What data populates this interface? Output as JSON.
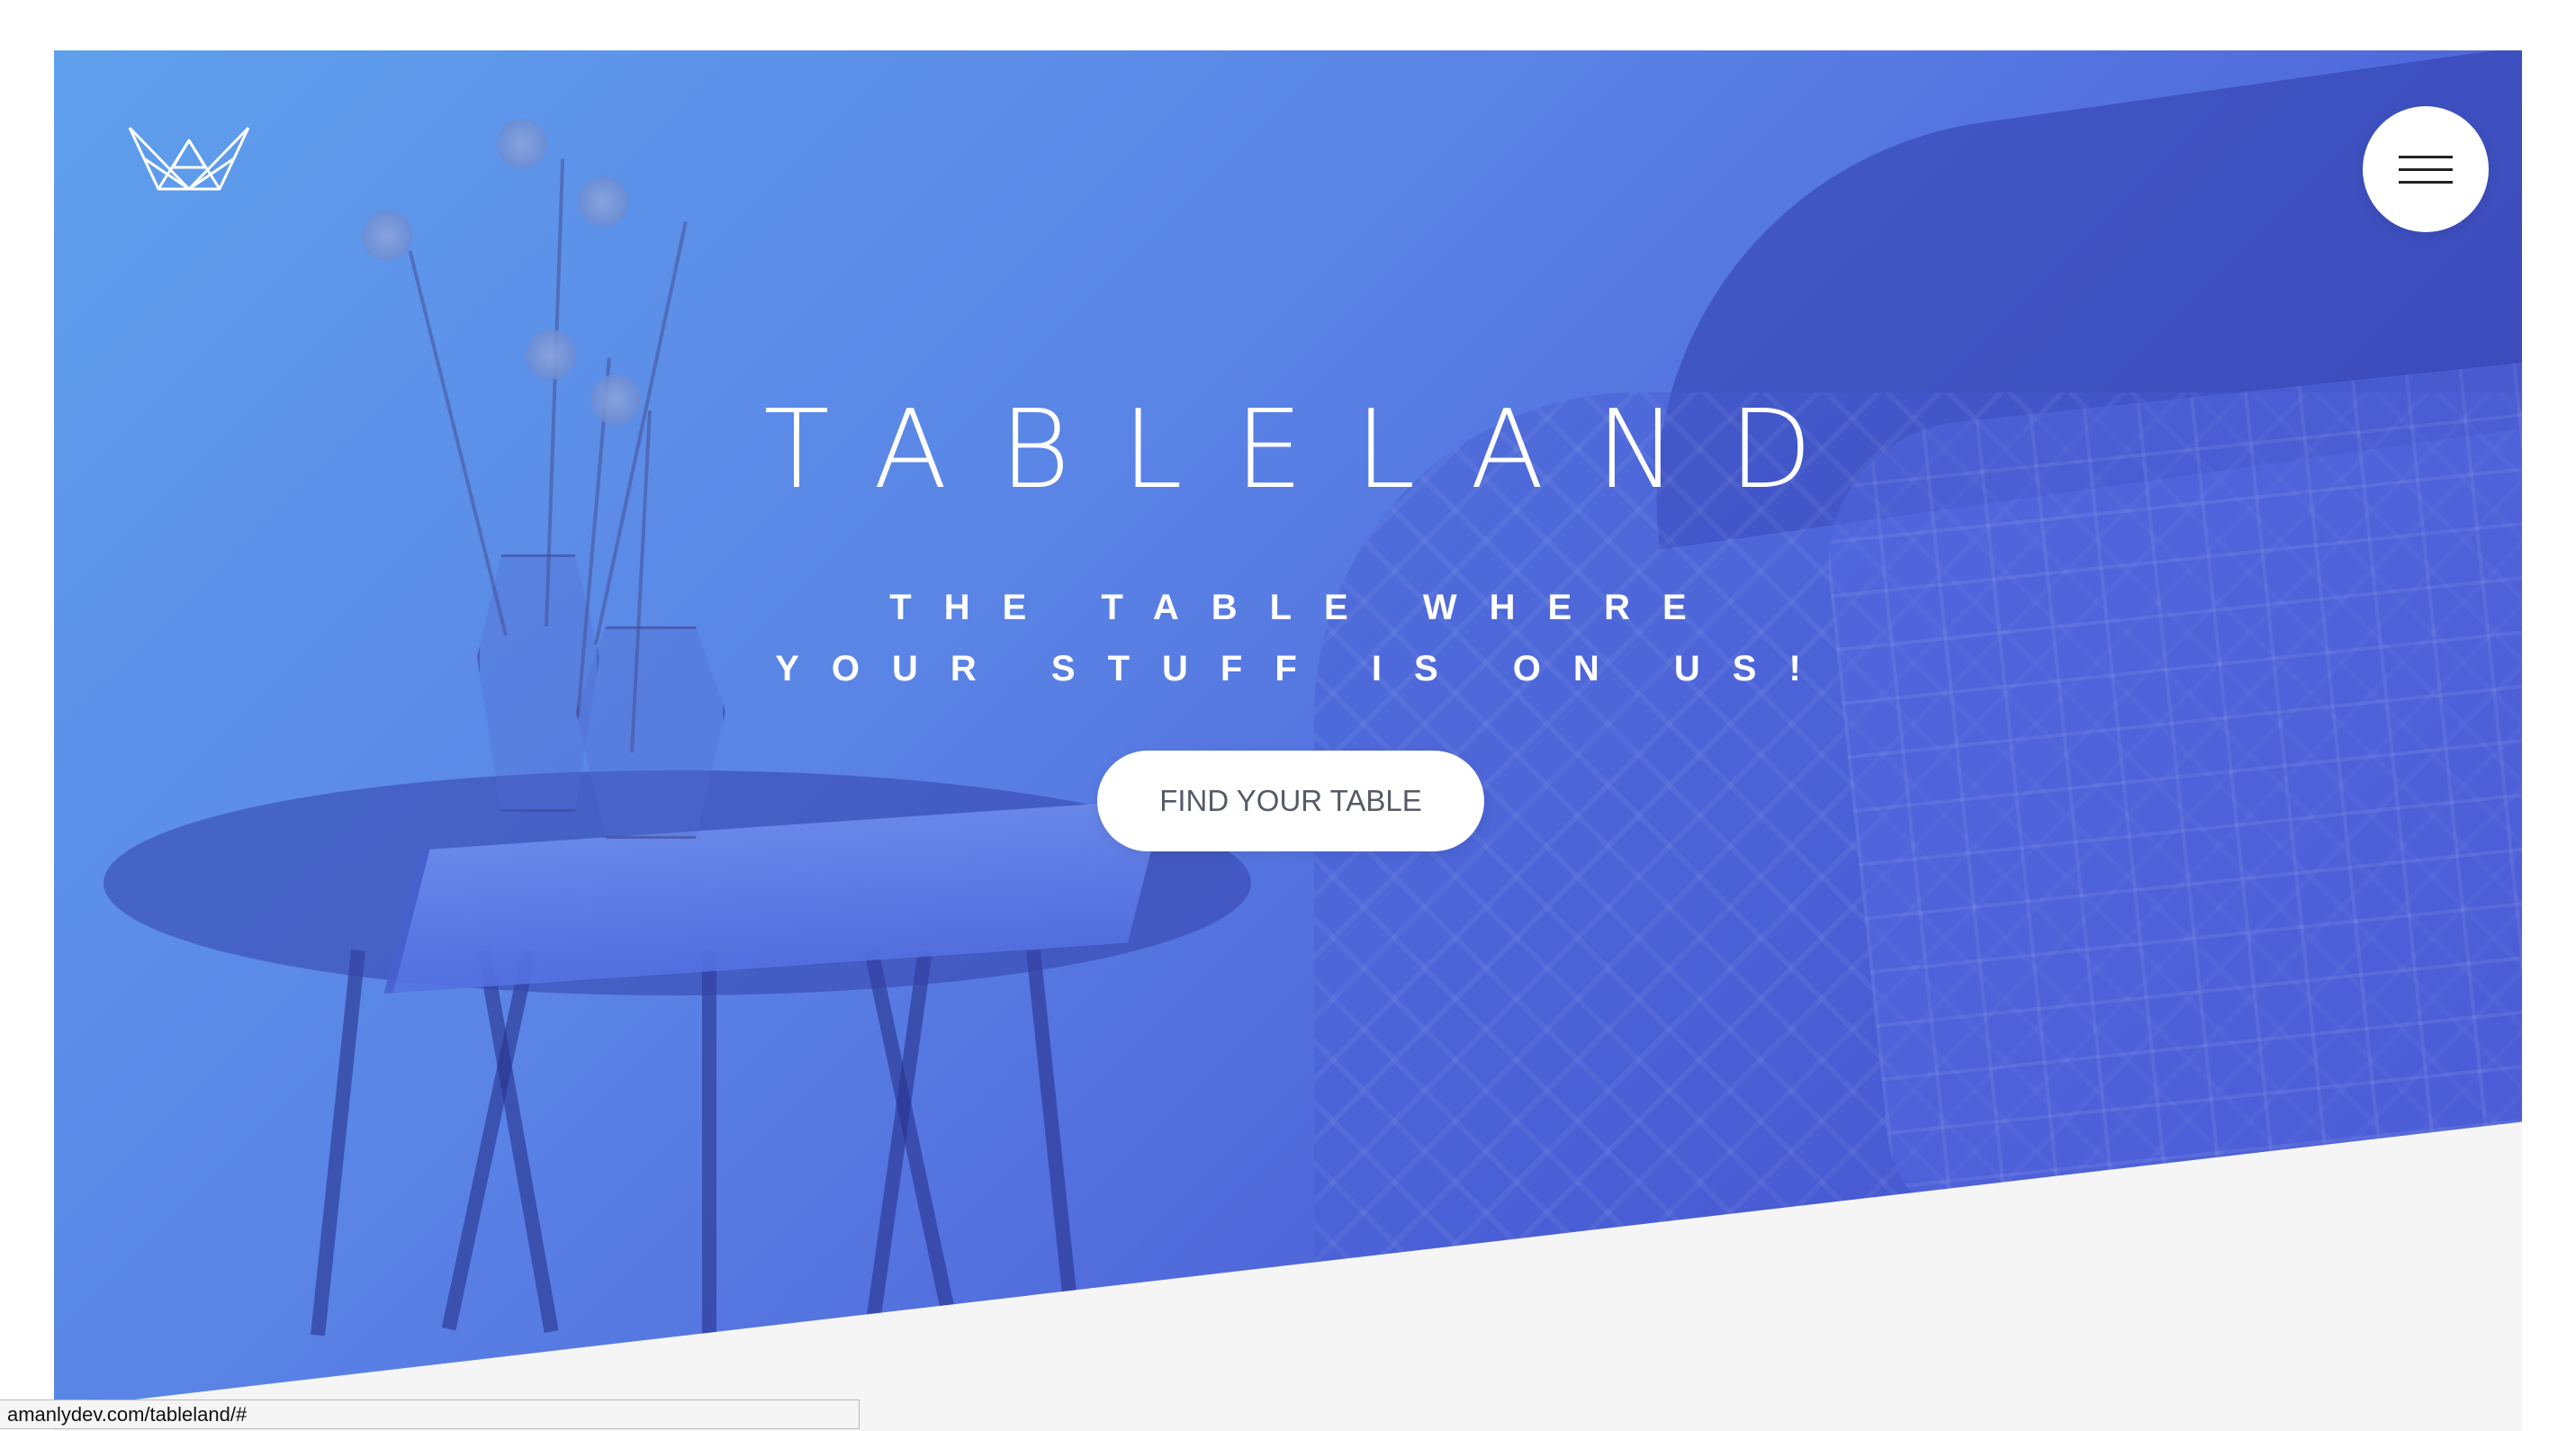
{
  "header": {
    "logo_icon": "crown-logo-icon",
    "menu_icon": "hamburger-menu-icon"
  },
  "hero": {
    "title": "TABLELAND",
    "tagline": "THE TABLE WHERE YOUR STUFF IS ON US!",
    "cta_label": "FIND YOUR TABLE"
  },
  "browser": {
    "status_url": "amanlydev.com/tableland/#"
  },
  "colors": {
    "gradient_start": "#5fa0ec",
    "gradient_end": "#3e46c4",
    "cta_background": "#ffffff",
    "cta_text": "#555a66",
    "section_bg": "#f5f5f6"
  }
}
